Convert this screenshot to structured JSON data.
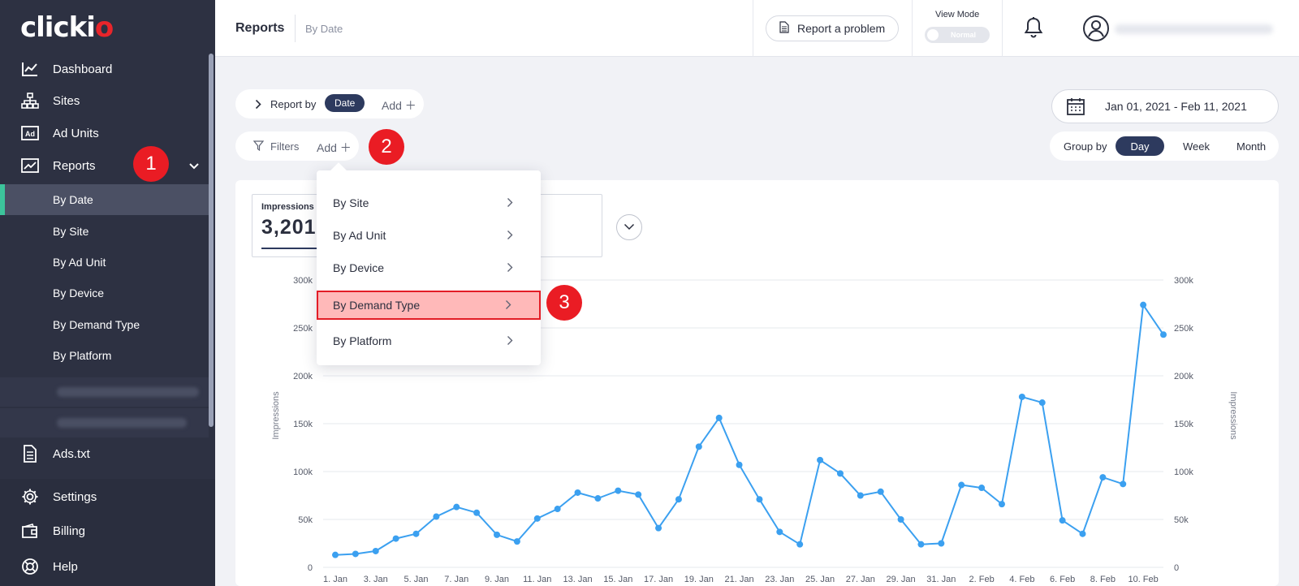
{
  "app": {
    "logo": "clickio"
  },
  "sidebar": {
    "items": [
      {
        "label": "Dashboard",
        "icon": "dashboard-icon"
      },
      {
        "label": "Sites",
        "icon": "sitemap-icon"
      },
      {
        "label": "Ad Units",
        "icon": "ad-icon"
      },
      {
        "label": "Reports",
        "icon": "reports-icon"
      }
    ],
    "reports_sub": [
      {
        "label": "By Date",
        "active": true
      },
      {
        "label": "By Site"
      },
      {
        "label": "By Ad Unit"
      },
      {
        "label": "By Device"
      },
      {
        "label": "By Demand Type"
      },
      {
        "label": "By Platform"
      }
    ],
    "bottom_items": [
      {
        "label": "Ads.txt",
        "icon": "document-icon"
      },
      {
        "label": "Settings",
        "icon": "gear-icon"
      },
      {
        "label": "Billing",
        "icon": "wallet-icon"
      },
      {
        "label": "Help",
        "icon": "lifebuoy-icon"
      }
    ]
  },
  "header": {
    "title": "Reports",
    "subtitle": "By Date",
    "report_problem": "Report a problem",
    "view_mode_label": "View Mode",
    "view_mode_value": "Normal"
  },
  "controls": {
    "report_by_label": "Report by",
    "report_by_value": "Date",
    "add_label": "Add",
    "filters_label": "Filters",
    "filters_add": "Add",
    "date_range": "Jan 01, 2021 - Feb 11, 2021",
    "group_by_label": "Group by",
    "group_by_options": [
      "Day",
      "Week",
      "Month"
    ],
    "group_by_selected": "Day"
  },
  "dropdown": {
    "items": [
      "By Site",
      "By Ad Unit",
      "By Device",
      "By Demand Type",
      "By Platform"
    ],
    "highlighted": "By Demand Type"
  },
  "annotations": [
    "1",
    "2",
    "3"
  ],
  "metric": {
    "label": "Impressions",
    "value": "3,201,"
  },
  "colors": {
    "accent": "#2d3a5e",
    "line": "#3ba0f0",
    "sidebar": "#2d3142",
    "active_bar": "#3cc49b",
    "badge": "#ea1c24"
  },
  "chart_data": {
    "type": "line",
    "ylabel": "Impressions",
    "y2label": "Impressions",
    "ylim": [
      0,
      300000
    ],
    "yticks": [
      "0",
      "50k",
      "100k",
      "150k",
      "200k",
      "250k",
      "300k"
    ],
    "xticks": [
      "1. Jan",
      "3. Jan",
      "5. Jan",
      "7. Jan",
      "9. Jan",
      "11. Jan",
      "13. Jan",
      "15. Jan",
      "17. Jan",
      "19. Jan",
      "21. Jan",
      "23. Jan",
      "25. Jan",
      "27. Jan",
      "29. Jan",
      "31. Jan",
      "2. Feb",
      "4. Feb",
      "6. Feb",
      "8. Feb",
      "10. Feb"
    ],
    "series": [
      {
        "values": [
          13000,
          14000,
          17000,
          30000,
          35000,
          53000,
          63000,
          57000,
          34000,
          27000,
          51000,
          61000,
          78000,
          72000,
          80000,
          76000,
          41000,
          71000,
          126000,
          156000,
          107000,
          71000,
          37000,
          24000,
          112000,
          98000,
          75000,
          79000,
          50000,
          24000,
          25000,
          86000,
          83000,
          66000,
          178000,
          172000,
          49000,
          35000,
          94000,
          87000,
          274000,
          243000
        ]
      }
    ],
    "grid": true
  }
}
